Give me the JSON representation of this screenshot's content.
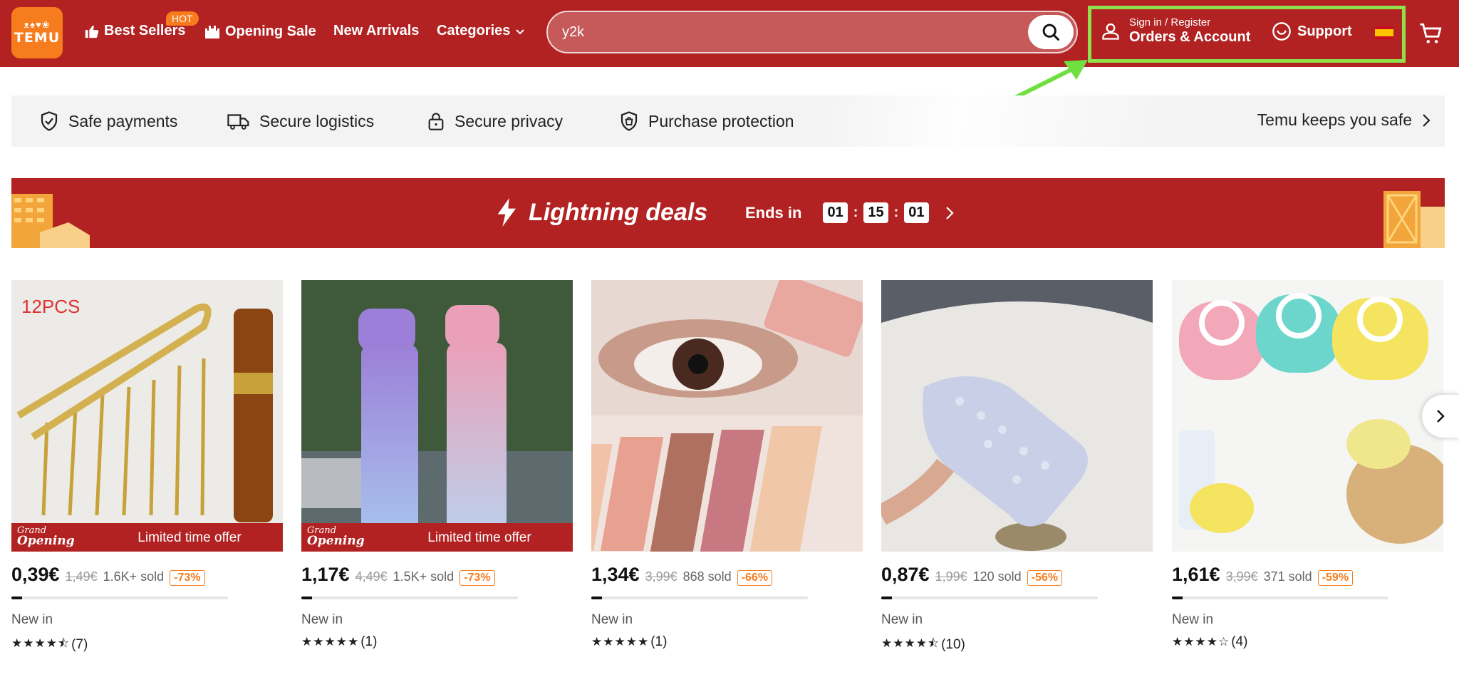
{
  "header": {
    "logo_glyphs": "ᴥ♠♥❀",
    "logo_text": "TEMU",
    "nav": {
      "best_sellers": "Best Sellers",
      "hot_badge": "HOT",
      "opening_sale": "Opening Sale",
      "new_arrivals": "New Arrivals",
      "categories": "Categories"
    },
    "search": {
      "value": "y2k",
      "placeholder": ""
    },
    "account": {
      "line1": "Sign in / Register",
      "line2": "Orders & Account"
    },
    "support": "Support",
    "highlight_color": "#8fe04a",
    "brand_color": "#b22222",
    "accent_color": "#f77c1e"
  },
  "safety_bar": {
    "items": [
      "Safe payments",
      "Secure logistics",
      "Secure privacy",
      "Purchase protection"
    ],
    "keeps_safe": "Temu keeps you safe"
  },
  "lightning": {
    "title": "Lightning deals",
    "ends_in": "Ends in",
    "hours": "01",
    "minutes": "15",
    "seconds": "01"
  },
  "products": [
    {
      "image_label": "12PCS",
      "ribbon_top": "Grand",
      "ribbon_bottom": "Opening",
      "offer": "Limited time offer",
      "price": "0,39€",
      "orig": "1,49€",
      "sold": "1.6K+ sold",
      "discount": "-73%",
      "progress": 0.05,
      "tag": "New in",
      "stars": "★★★★⯪",
      "count": "(7)"
    },
    {
      "image_label": "",
      "ribbon_top": "Grand",
      "ribbon_bottom": "Opening",
      "offer": "Limited time offer",
      "price": "1,17€",
      "orig": "4,49€",
      "sold": "1.5K+ sold",
      "discount": "-73%",
      "progress": 0.05,
      "tag": "New in",
      "stars": "★★★★★",
      "count": "(1)"
    },
    {
      "image_label": "",
      "ribbon_top": "",
      "ribbon_bottom": "",
      "offer": "",
      "price": "1,34€",
      "orig": "3,99€",
      "sold": "868 sold",
      "discount": "-66%",
      "progress": 0.05,
      "tag": "New in",
      "stars": "★★★★★",
      "count": "(1)"
    },
    {
      "image_label": "",
      "ribbon_top": "",
      "ribbon_bottom": "",
      "offer": "",
      "price": "0,87€",
      "orig": "1,99€",
      "sold": "120 sold",
      "discount": "-56%",
      "progress": 0.05,
      "tag": "New in",
      "stars": "★★★★⯪",
      "count": "(10)"
    },
    {
      "image_label": "",
      "ribbon_top": "",
      "ribbon_bottom": "",
      "offer": "",
      "price": "1,61€",
      "orig": "3,99€",
      "sold": "371 sold",
      "discount": "-59%",
      "progress": 0.05,
      "tag": "New in",
      "stars": "★★★★☆",
      "count": "(4)"
    }
  ]
}
